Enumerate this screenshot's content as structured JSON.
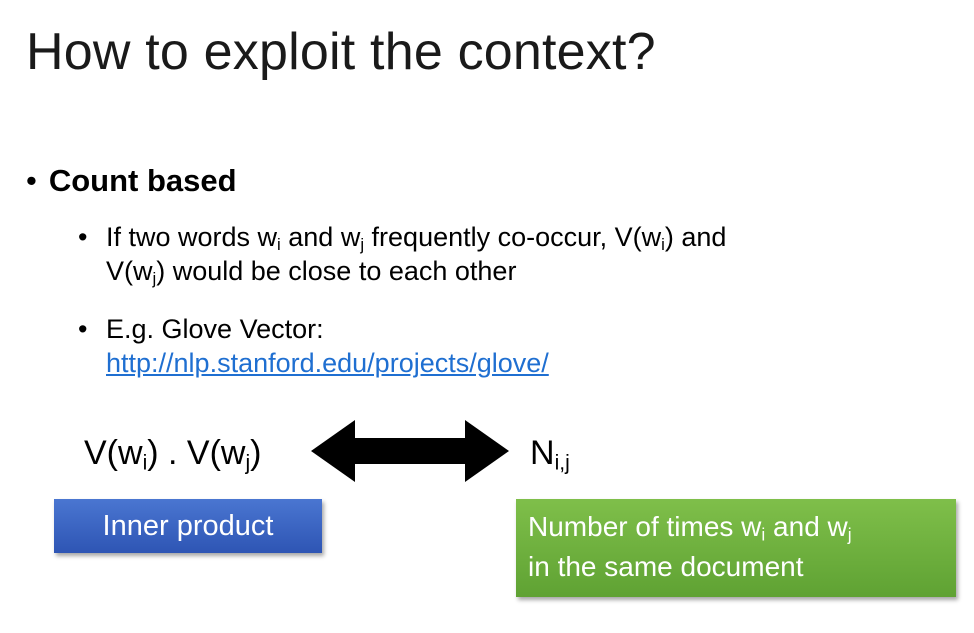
{
  "slide": {
    "title": "How to exploit the context?",
    "bullet1": {
      "marker": "•",
      "label": "Count based"
    },
    "sub1": {
      "marker": "•",
      "line1_a": "If two words w",
      "sub_i": "i",
      "line1_b": " and w",
      "sub_j": "j",
      "line1_c": " frequently co-occur, V(w",
      "sub_i2": "i",
      "line1_d": ") and",
      "line2_a": "V(w",
      "sub_j2": "j",
      "line2_b": ") would be close to each other"
    },
    "sub2": {
      "marker": "•",
      "line1": "E.g. Glove Vector:",
      "link": "http://nlp.stanford.edu/projects/glove/"
    },
    "formula_left": {
      "a": "V(w",
      "sub_i": "i",
      "b": ") . V(w",
      "sub_j": "j",
      "c": ")"
    },
    "formula_right": {
      "a": "N",
      "sub": "i,j"
    },
    "box_blue": {
      "label": "Inner product",
      "color": "#3b63c4"
    },
    "box_green": {
      "line1_a": "Number of times w",
      "sub_i": "i",
      "line1_b": " and w",
      "sub_j": "j",
      "line2": "in the same document",
      "color": "#6fb13e"
    },
    "arrow_icon": "double-headed-arrow-icon"
  }
}
